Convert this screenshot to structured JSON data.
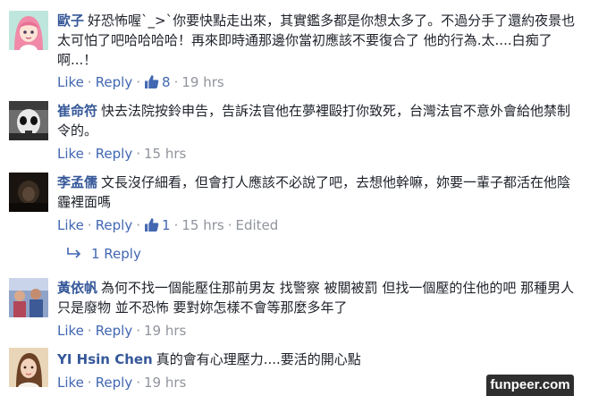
{
  "comments": [
    {
      "author": "歐子",
      "text": "好恐怖喔`_>`你要快點走出來，其實鑑多都是你想太多了。不過分手了還約夜景也太可怕了吧哈哈哈哈！再來即時通那邊你當初應該不要復合了 他的行為.太....白痴了啊...！",
      "like": "Like",
      "reply": "Reply",
      "like_count": "8",
      "time": "19 hrs",
      "avatar_icon": "anime-girl-avatar"
    },
    {
      "author": "崔命符",
      "text": "快去法院按鈴申告，告訴法官他在夢裡毆打你致死，台灣法官不意外會給他禁制令的。",
      "like": "Like",
      "reply": "Reply",
      "time": "15 hrs",
      "avatar_icon": "skull-mask-avatar"
    },
    {
      "author": "李孟儒",
      "text": "文長沒仔細看，但會打人應該不必說了吧，去想他幹嘛，妳要一輩子都活在他陰霾裡面嗎",
      "like": "Like",
      "reply": "Reply",
      "like_count": "1",
      "time": "15 hrs",
      "edited": "Edited",
      "avatar_icon": "dark-photo-avatar",
      "replies_label": "1 Reply"
    },
    {
      "author": "黃依帆",
      "text": "為何不找一個能壓住那前男友 找警察 被關被罰 但找一個壓的住他的吧 那種男人只是廢物 並不恐怖 要對妳怎樣不會等那麼多年了",
      "like": "Like",
      "reply": "Reply",
      "time": "19 hrs",
      "avatar_icon": "group-photo-avatar"
    },
    {
      "author": "YI Hsin Chen",
      "text": "真的會有心理壓力....要活的開心點",
      "like": "Like",
      "reply": "Reply",
      "time": "19 hrs",
      "avatar_icon": "woman-photo-avatar"
    }
  ],
  "watermark": "funpeer.com",
  "colors": {
    "link": "#4267b2",
    "author": "#365899",
    "meta": "#90949c",
    "text": "#1d2129"
  }
}
